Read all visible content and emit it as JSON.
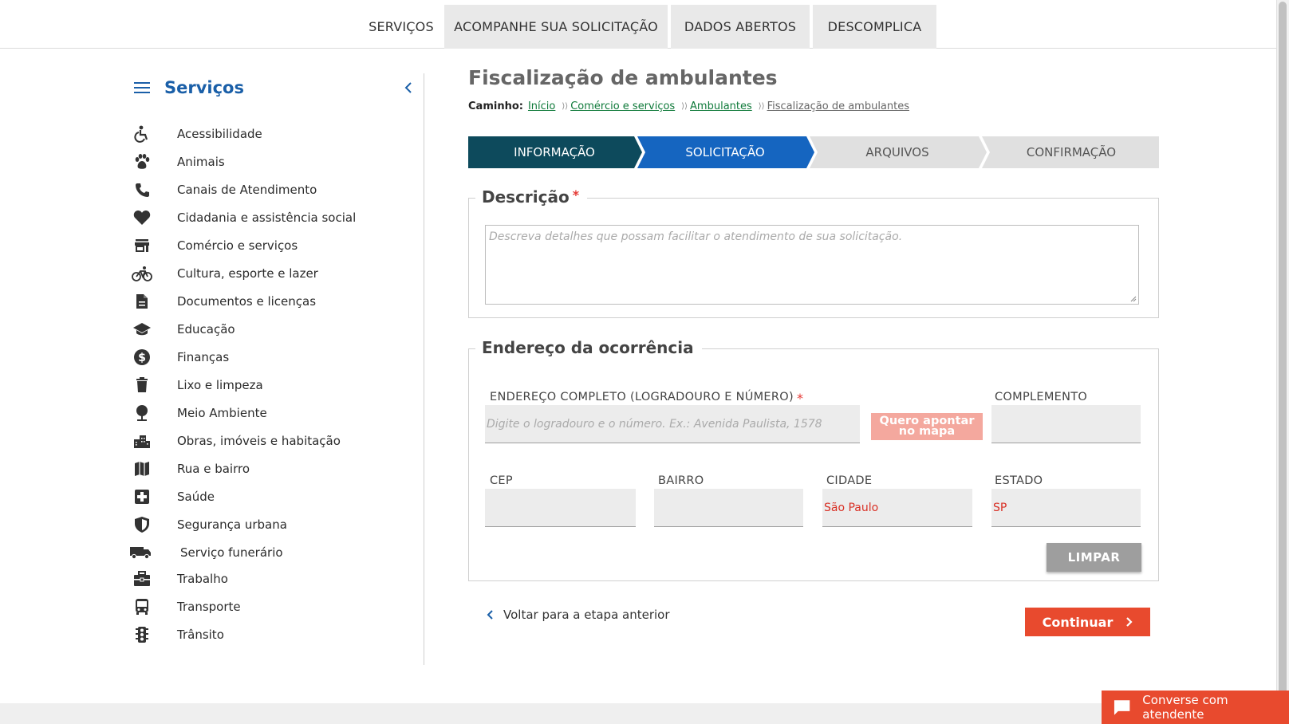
{
  "topnav": {
    "tabs": [
      {
        "label": "SERVIÇOS"
      },
      {
        "label": "ACOMPANHE SUA SOLICITAÇÃO"
      },
      {
        "label": "DADOS ABERTOS"
      },
      {
        "label": "DESCOMPLICA"
      }
    ]
  },
  "sidebar": {
    "title": "Serviços",
    "items": [
      {
        "label": "Acessibilidade",
        "icon": "accessibility-icon"
      },
      {
        "label": "Animais",
        "icon": "paw-icon"
      },
      {
        "label": "Canais de Atendimento",
        "icon": "phone-icon"
      },
      {
        "label": "Cidadania e assistência social",
        "icon": "heart-icon"
      },
      {
        "label": "Comércio e serviços",
        "icon": "store-icon"
      },
      {
        "label": "Cultura, esporte e lazer",
        "icon": "bicycle-icon"
      },
      {
        "label": "Documentos e licenças",
        "icon": "document-icon"
      },
      {
        "label": "Educação",
        "icon": "graduation-cap-icon"
      },
      {
        "label": "Finanças",
        "icon": "dollar-icon"
      },
      {
        "label": "Lixo e limpeza",
        "icon": "trash-icon"
      },
      {
        "label": "Meio Ambiente",
        "icon": "tree-icon"
      },
      {
        "label": "Obras, imóveis e habitação",
        "icon": "buildings-icon"
      },
      {
        "label": "Rua e bairro",
        "icon": "map-icon"
      },
      {
        "label": "Saúde",
        "icon": "health-cross-icon"
      },
      {
        "label": "Segurança urbana",
        "icon": "shield-icon"
      },
      {
        "label": "Serviço funerário",
        "icon": "truck-icon"
      },
      {
        "label": "Trabalho",
        "icon": "briefcase-icon"
      },
      {
        "label": "Transporte",
        "icon": "bus-icon"
      },
      {
        "label": "Trânsito",
        "icon": "traffic-light-icon"
      }
    ]
  },
  "main": {
    "title": "Fiscalização de ambulantes",
    "breadcrumb": {
      "label": "Caminho:",
      "items": [
        "Início",
        "Comércio e serviços",
        "Ambulantes",
        "Fiscalização de ambulantes"
      ]
    },
    "steps": [
      {
        "label": "INFORMAÇÃO",
        "state": "done"
      },
      {
        "label": "SOLICITAÇÃO",
        "state": "active"
      },
      {
        "label": "ARQUIVOS",
        "state": "pending"
      },
      {
        "label": "CONFIRMAÇÃO",
        "state": "pending"
      }
    ],
    "descricao": {
      "legend": "Descrição",
      "required_mark": "*",
      "placeholder": "Descreva detalhes que possam facilitar o atendimento de sua solicitação."
    },
    "endereco": {
      "legend": "Endereço da ocorrência",
      "full_address_label": "ENDEREÇO COMPLETO (LOGRADOURO E NÚMERO)",
      "required_mark": "*",
      "full_address_placeholder": "Digite o logradouro e o número. Ex.: Avenida Paulista, 1578",
      "map_button": "Quero apontar no mapa",
      "complemento_label": "COMPLEMENTO",
      "complemento_value": "",
      "cep_label": "CEP",
      "cep_value": "",
      "bairro_label": "BAIRRO",
      "bairro_value": "",
      "cidade_label": "CIDADE",
      "cidade_value": "São Paulo",
      "estado_label": "ESTADO",
      "estado_value": "SP",
      "clear_button": "LIMPAR"
    },
    "back_link": "Voltar para a etapa anterior",
    "continue_button": "Continuar"
  },
  "chat": {
    "label": "Converse com atendente"
  },
  "colors": {
    "brand_blue": "#1a5fa8",
    "step_done": "#0d4a5c",
    "step_active": "#1565c0",
    "step_pending": "#e0e0e0",
    "accent_orange": "#e84a2e",
    "link_green": "#0f7a3a"
  }
}
